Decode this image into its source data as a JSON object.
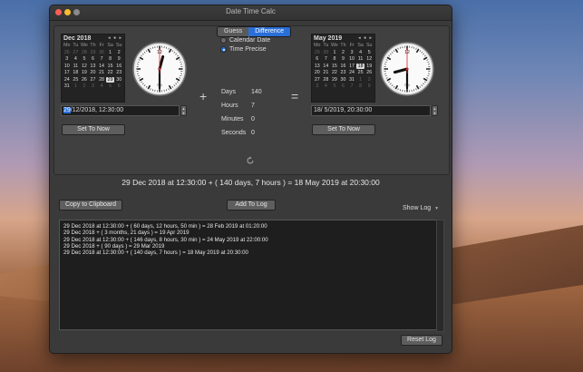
{
  "window": {
    "title": "Date Time Calc"
  },
  "segments": [
    {
      "label": "Guess",
      "active": false
    },
    {
      "label": "Difference",
      "active": true
    }
  ],
  "left_calendar": {
    "month": "Dec 2018",
    "nav": "◂ ● ▸",
    "dow": [
      "Mo",
      "Tu",
      "We",
      "Th",
      "Fr",
      "Sa",
      "Su"
    ],
    "days": [
      {
        "t": "26",
        "o": true
      },
      {
        "t": "27",
        "o": true
      },
      {
        "t": "28",
        "o": true
      },
      {
        "t": "29",
        "o": true
      },
      {
        "t": "30",
        "o": true
      },
      {
        "t": "1"
      },
      {
        "t": "2"
      },
      {
        "t": "3"
      },
      {
        "t": "4"
      },
      {
        "t": "5"
      },
      {
        "t": "6"
      },
      {
        "t": "7"
      },
      {
        "t": "8"
      },
      {
        "t": "9"
      },
      {
        "t": "10"
      },
      {
        "t": "11"
      },
      {
        "t": "12"
      },
      {
        "t": "13"
      },
      {
        "t": "14"
      },
      {
        "t": "15"
      },
      {
        "t": "16"
      },
      {
        "t": "17"
      },
      {
        "t": "18"
      },
      {
        "t": "19"
      },
      {
        "t": "20"
      },
      {
        "t": "21"
      },
      {
        "t": "22"
      },
      {
        "t": "23"
      },
      {
        "t": "24"
      },
      {
        "t": "25"
      },
      {
        "t": "26"
      },
      {
        "t": "27"
      },
      {
        "t": "28"
      },
      {
        "t": "29",
        "sel": true
      },
      {
        "t": "30"
      },
      {
        "t": "31"
      },
      {
        "t": "1",
        "o": true
      },
      {
        "t": "2",
        "o": true
      },
      {
        "t": "3",
        "o": true
      },
      {
        "t": "4",
        "o": true
      },
      {
        "t": "5",
        "o": true
      },
      {
        "t": "6",
        "o": true
      }
    ]
  },
  "right_calendar": {
    "month": "May 2019",
    "nav": "◂ ● ▸",
    "dow": [
      "Mo",
      "Tu",
      "We",
      "Th",
      "Fr",
      "Sa",
      "Su"
    ],
    "days": [
      {
        "t": "29",
        "o": true
      },
      {
        "t": "30",
        "o": true
      },
      {
        "t": "1"
      },
      {
        "t": "2"
      },
      {
        "t": "3"
      },
      {
        "t": "4"
      },
      {
        "t": "5"
      },
      {
        "t": "6"
      },
      {
        "t": "7"
      },
      {
        "t": "8"
      },
      {
        "t": "9"
      },
      {
        "t": "10"
      },
      {
        "t": "11"
      },
      {
        "t": "12"
      },
      {
        "t": "13"
      },
      {
        "t": "14"
      },
      {
        "t": "15"
      },
      {
        "t": "16"
      },
      {
        "t": "17"
      },
      {
        "t": "18",
        "sel": true
      },
      {
        "t": "19"
      },
      {
        "t": "20"
      },
      {
        "t": "21"
      },
      {
        "t": "22"
      },
      {
        "t": "23"
      },
      {
        "t": "24"
      },
      {
        "t": "25"
      },
      {
        "t": "26"
      },
      {
        "t": "27"
      },
      {
        "t": "28"
      },
      {
        "t": "29"
      },
      {
        "t": "30"
      },
      {
        "t": "31"
      },
      {
        "t": "1",
        "o": true
      },
      {
        "t": "2",
        "o": true
      },
      {
        "t": "3",
        "o": true
      },
      {
        "t": "4",
        "o": true
      },
      {
        "t": "5",
        "o": true
      },
      {
        "t": "6",
        "o": true
      },
      {
        "t": "7",
        "o": true
      },
      {
        "t": "8",
        "o": true
      },
      {
        "t": "9",
        "o": true
      }
    ]
  },
  "left_clock": {
    "hour": 12,
    "minute": 30,
    "second": 0
  },
  "right_clock": {
    "hour": 20,
    "minute": 30,
    "second": 0
  },
  "clock_labels": {
    "am_pm_left": "PM",
    "am_pm_right": "PM"
  },
  "left_date": {
    "highlight": "29",
    "rest": "/12/2018, 12:30:00"
  },
  "right_date": {
    "value": "18/  5/2019, 20:30:00"
  },
  "buttons": {
    "set_now_left": "Set To Now",
    "set_now_right": "Set To Now",
    "copy": "Copy to Clipboard",
    "add_log": "Add To Log",
    "reset_log": "Reset Log"
  },
  "mode": {
    "calendar_date": "Calendar Date",
    "time_precise": "Time Precise",
    "selected": "time_precise"
  },
  "operators": {
    "plus": "+",
    "equals": "="
  },
  "difference": {
    "days_label": "Days",
    "days": "140",
    "hours_label": "Hours",
    "hours": "7",
    "minutes_label": "Minutes",
    "minutes": "0",
    "seconds_label": "Seconds",
    "seconds": "0"
  },
  "result": "29 Dec 2018 at 12:30:00 + ( 140 days, 7 hours ) = 18 May 2019 at 20:30:00",
  "show_log": "Show Log",
  "log": [
    "29 Dec 2018 at 12:30:00 + ( 60 days, 12 hours, 50 min ) = 28 Feb 2019 at 01:20:00",
    "29 Dec 2018 + ( 3 months, 21 days ) = 19 Apr 2019",
    "29 Dec 2018 at 12:30:00 + ( 146 days, 8 hours, 30 min ) = 24 May 2019 at 22:00:00",
    "29 Dec 2018 + ( 90 days ) = 29 Mar 2019",
    "29 Dec 2018 at 12:30:00 + ( 140 days, 7 hours ) = 18 May 2019 at 20:30:00"
  ]
}
